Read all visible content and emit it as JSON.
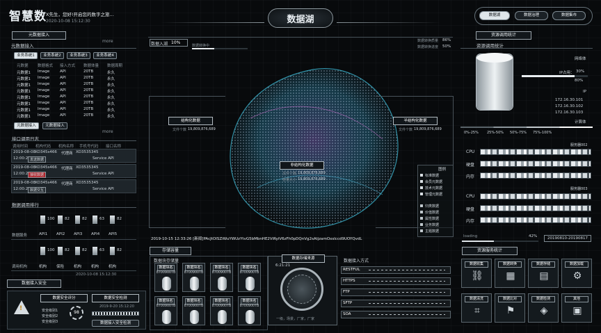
{
  "brand": {
    "logo": "智慧数",
    "greeting": "X先生，您好!开启您的数字之旅...",
    "datetime": "2020-10-08 15:12:30"
  },
  "header": {
    "center_title": "数据湖",
    "nav": [
      "数据湖",
      "数据治理",
      "数据集市"
    ],
    "nav_selected": 0
  },
  "meta_access": {
    "title": "元数据接入",
    "subtitle": "元数据接入",
    "more": "more",
    "tabs": [
      "业务系统1",
      "业务系统2",
      "业务系统3",
      "业务系统4"
    ],
    "columns": [
      "元数据",
      "数据格式",
      "接入方式",
      "数据体量",
      "数据周期"
    ],
    "rows": [
      [
        "元数据1",
        "Image",
        "API",
        "20TB",
        "永久"
      ],
      [
        "元数据1",
        "Image",
        "API",
        "20TB",
        "永久"
      ],
      [
        "元数据1",
        "Image",
        "API",
        "20TB",
        "永久"
      ],
      [
        "元数据1",
        "Image",
        "API",
        "20TB",
        "永久"
      ],
      [
        "元数据1",
        "Image",
        "API",
        "20TB",
        "永久"
      ],
      [
        "元数据1",
        "Image",
        "API",
        "20TB",
        "永久"
      ],
      [
        "元数据1",
        "Image",
        "API",
        "20TB",
        "永久"
      ],
      [
        "元数据1",
        "Image",
        "API",
        "20TB",
        "永久"
      ]
    ],
    "buttons": [
      "元数据接入",
      "元数据接入"
    ]
  },
  "api_log": {
    "title": "接口调用日志",
    "more": "more",
    "columns": [
      "调用时间",
      "机构代码",
      "机构名称",
      "手机号代码",
      "接口名称"
    ],
    "entries": [
      {
        "date": "2019-08-08",
        "time": "12:00:20",
        "code": "XD345s466",
        "name": "代理商",
        "phone": "XD3535345",
        "api": "Service API",
        "badge": "发送数据"
      },
      {
        "date": "2019-08-08",
        "time": "12:00:20",
        "code": "XD345s466",
        "name": "代理商",
        "phone": "XD3535345",
        "api": "Service API",
        "badge": "接收数据"
      },
      {
        "date": "2019-08-08",
        "time": "12:00:20",
        "code": "XD345s466",
        "name": "代理商",
        "phone": "XD3535345",
        "api": "Service API",
        "badge": "数据交互"
      }
    ]
  },
  "ranking": {
    "title": "数据调用排行",
    "rows": [
      {
        "label": "数据服务",
        "items": [
          {
            "name": "API1",
            "v": "100"
          },
          {
            "name": "API2",
            "v": "82"
          },
          {
            "name": "API3",
            "v": "82"
          },
          {
            "name": "API4",
            "v": "63"
          },
          {
            "name": "API5",
            "v": "82"
          }
        ]
      },
      {
        "label": "调用机构",
        "items": [
          {
            "name": "机构",
            "v": "100"
          },
          {
            "name": "保险",
            "v": "82"
          },
          {
            "name": "机构",
            "v": "82"
          },
          {
            "name": "机构",
            "v": "63"
          },
          {
            "name": "机构",
            "v": "82"
          }
        ]
      }
    ],
    "date": "2020-10-08 15:12:30"
  },
  "security": {
    "title": "数据接入安全",
    "score_label": "数据安全评分",
    "check_label": "数据安全检测",
    "level1": "安全级别1",
    "level2": "安全级别2",
    "level3": "安全级别3",
    "score": "98",
    "check_time": "2019-9-20 15:12:20",
    "button": "数据接入安全检测"
  },
  "access_status": {
    "label": "数据入湖",
    "percent": "10%",
    "running": "数据转换中",
    "pct1": "86%",
    "pct2": "50%",
    "label1": "数据转换质量",
    "label2": "数据转换进度"
  },
  "lake": {
    "structured": {
      "title": "结构化数据",
      "label": "文件个数",
      "value": "19,809,876,689"
    },
    "semi": {
      "title": "半结构化数据",
      "label": "文件个数",
      "value": "19,809,876,689"
    },
    "unstructured": {
      "title": "非结构化数据",
      "label1": "文件个数",
      "value1": "19,809,876,689",
      "label2": "容量大小",
      "value2": "19,809,876,689"
    },
    "ticker": "2019-10-15 12:33:26 [新闻]PAcJtOISZiWuYWUzYtvG5bMbnHE2ViRyiV6zFh0pDQnVg2sAtjzamOxslccd9UOYQvdL"
  },
  "legend": {
    "title": "图例",
    "group1": [
      "标准数据",
      "会员元数据",
      "技术元数据",
      "管理元数据"
    ],
    "group2": [
      "归类数据",
      "价值数据",
      "属性数据",
      "业务数据",
      "主题数据"
    ]
  },
  "storage": {
    "title": "存储容量",
    "sub": "数据块存储量",
    "cards": [
      {
        "lbl": "数据块名",
        "val": "8700900TB"
      },
      {
        "lbl": "数据块名",
        "val": "8700900TB"
      },
      {
        "lbl": "数据块名",
        "val": "8700900TB"
      },
      {
        "lbl": "数据块名",
        "val": "8700900TB"
      },
      {
        "lbl": "数据块名",
        "val": "8700900TB"
      },
      {
        "lbl": "数据块名",
        "val": "8700900TB"
      },
      {
        "lbl": "数据块名",
        "val": "8700900TB"
      },
      {
        "lbl": "数据块名",
        "val": "8700900TB"
      }
    ]
  },
  "gauge": {
    "title": "数据存储来源",
    "time": "6:21:21",
    "footer": "一级，场景，厂家，厂家"
  },
  "protocols": {
    "title": "数据接入方式",
    "items": [
      "RESTFUL",
      "HTTPS",
      "FTP",
      "SFTP",
      "SOA"
    ]
  },
  "resource": {
    "title": "资源调用统计",
    "sub": "资源调用统计",
    "net": "网络体",
    "ip_title": "IP占用：",
    "ip_value": "30%",
    "pct": "80%",
    "ip_label": "IP",
    "ips": [
      "172.16.30.101",
      "172.16.30.102",
      "172.16.30.103"
    ],
    "calc": "计算体",
    "scale": [
      "0%-25%",
      "25%-50%",
      "50%-75%",
      "75%-100%"
    ],
    "server1": "服务器002",
    "server2": "服务器003",
    "metrics": [
      "CPU",
      "硬盘",
      "内存"
    ],
    "loading": "loading",
    "loading_pct": "42%",
    "range": "20190810-20190817"
  },
  "services": {
    "title": "资源服务统计",
    "cards": [
      "数据收集",
      "数据转换",
      "数据存储",
      "数据加载",
      "数据清洗",
      "数据比对",
      "数据检测",
      "其他"
    ]
  },
  "colors": {
    "accent": "#e8eef2",
    "panel": "#141a1e",
    "line": "#3a444b"
  }
}
